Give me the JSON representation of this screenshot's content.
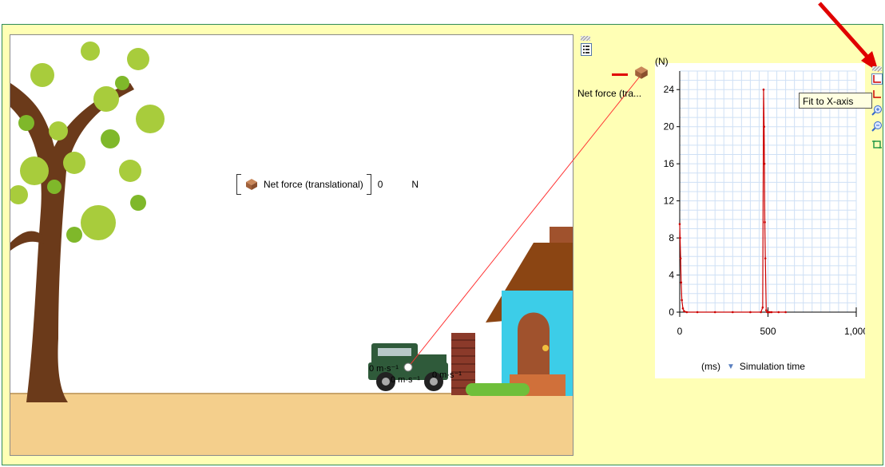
{
  "meter": {
    "label": "Net force (translational)",
    "value": "0",
    "unit": "N",
    "icon": "box-icon"
  },
  "graph": {
    "legend_label": "Net force (tra...",
    "y_unit": "(N)",
    "x_unit": "(ms)",
    "x_title": "Simulation time",
    "series_color": "#cc0000"
  },
  "toolbar": {
    "tooltip": "Fit to X-axis"
  },
  "vectors": {
    "label_a": "0 m·s⁻¹",
    "label_b": "0 m·s⁻¹",
    "label_c": "0 m·s⁻¹"
  },
  "chart_data": {
    "type": "line",
    "ylabel": "(N)",
    "xlabel": "Simulation time",
    "x_unit": "(ms)",
    "xlim": [
      0,
      1000
    ],
    "ylim": [
      0,
      26
    ],
    "xticks": [
      "0",
      "500",
      "1,000"
    ],
    "yticks": [
      "0",
      "4",
      "8",
      "12",
      "16",
      "20",
      "24"
    ],
    "grid": true,
    "series": [
      {
        "x": [
          0,
          2,
          5,
          8,
          12,
          18,
          25,
          40,
          100,
          200,
          300,
          400,
          460,
          470,
          475,
          478,
          480,
          482,
          485,
          490,
          495,
          500,
          505,
          510,
          520,
          560,
          600
        ],
        "y": [
          9.5,
          8.0,
          5.8,
          3.2,
          1.3,
          0.4,
          0.1,
          0,
          0,
          0,
          0,
          0,
          0,
          0.5,
          24,
          20,
          16,
          9.7,
          5.8,
          0.2,
          0,
          0,
          0,
          0,
          0,
          0,
          0
        ]
      }
    ]
  }
}
